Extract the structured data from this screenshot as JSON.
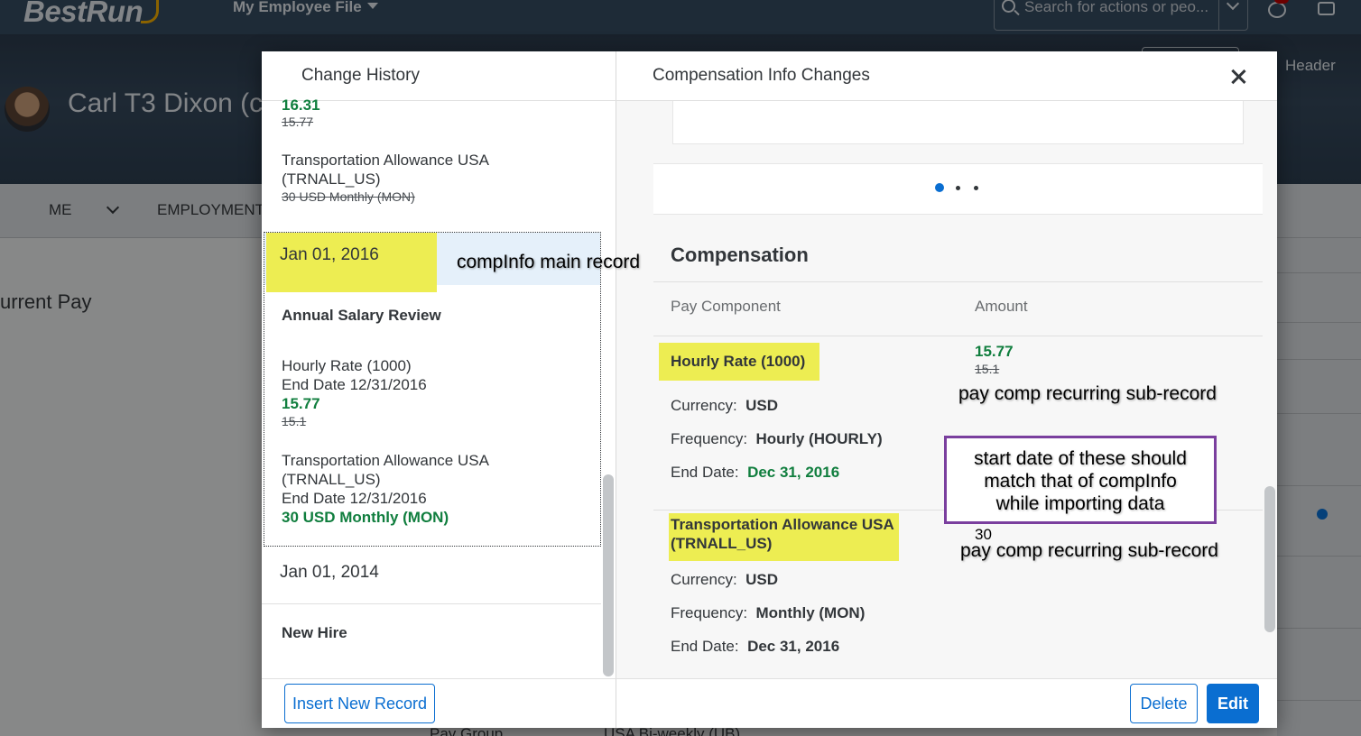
{
  "shell": {
    "logo": "BestRun",
    "app_menu": "My Employee File",
    "search_placeholder": "Search for actions or peo..."
  },
  "header": {
    "employee_name": "Carl T3 Dixon (c",
    "link": "Header"
  },
  "tabs": {
    "me": "ME",
    "employment": "EMPLOYMENT"
  },
  "background": {
    "current_pay": "urrent Pay",
    "pay_group_label": "Pay Group",
    "pay_group_value": "USA Bi-weekly (UB)"
  },
  "dialog": {
    "left_title": "Change History",
    "right_title": "Compensation Info Changes",
    "left_list": {
      "top_partial": {
        "new_value": "16.31",
        "old_value": "15.77",
        "item_line1": "Transportation Allowance USA",
        "item_line2": "(TRNALL_US)",
        "item_old": "30 USD Monthly (MON)"
      },
      "selected": {
        "date": "Jan 01, 2016",
        "event": "Annual Salary Review",
        "hourly_label": "Hourly Rate (1000)",
        "hourly_end": "End Date 12/31/2016",
        "hourly_new": "15.77",
        "hourly_old": "15.1",
        "transport_line1": "Transportation Allowance USA",
        "transport_line2": "(TRNALL_US)",
        "transport_end": "End Date 12/31/2016",
        "transport_new": "30 USD Monthly (MON)"
      },
      "next": {
        "date": "Jan 01, 2014",
        "event": "New Hire"
      }
    },
    "right_panel": {
      "section_title": "Compensation",
      "col_pay_component": "Pay Component",
      "col_amount": "Amount",
      "rows": [
        {
          "component": "Hourly Rate (1000)",
          "amount_new": "15.77",
          "amount_old": "15.1",
          "currency_label": "Currency:",
          "currency": "USD",
          "frequency_label": "Frequency:",
          "frequency": "Hourly (HOURLY)",
          "end_label": "End Date:",
          "end_date": "Dec 31, 2016"
        },
        {
          "component_line1": "Transportation Allowance USA",
          "component_line2": "(TRNALL_US)",
          "amount": "30",
          "currency_label": "Currency:",
          "currency": "USD",
          "frequency_label": "Frequency:",
          "frequency": "Monthly (MON)",
          "end_label": "End Date:",
          "end_date": "Dec 31, 2016"
        }
      ]
    },
    "footer": {
      "insert_button": "Insert New Record",
      "delete_button": "Delete",
      "edit_button": "Edit"
    }
  },
  "annotations": {
    "main_record": "compInfo main record",
    "sub_record_1": "pay comp recurring sub-record",
    "sub_record_2": "pay comp recurring sub-record",
    "note_line1": "start date of these should",
    "note_line2": "match that of compInfo",
    "note_line3": "while importing data"
  },
  "colors": {
    "accent": "#0a6ed1",
    "positive": "#107e3e",
    "highlight": "#eded52",
    "note_border": "#7a3f9e"
  }
}
